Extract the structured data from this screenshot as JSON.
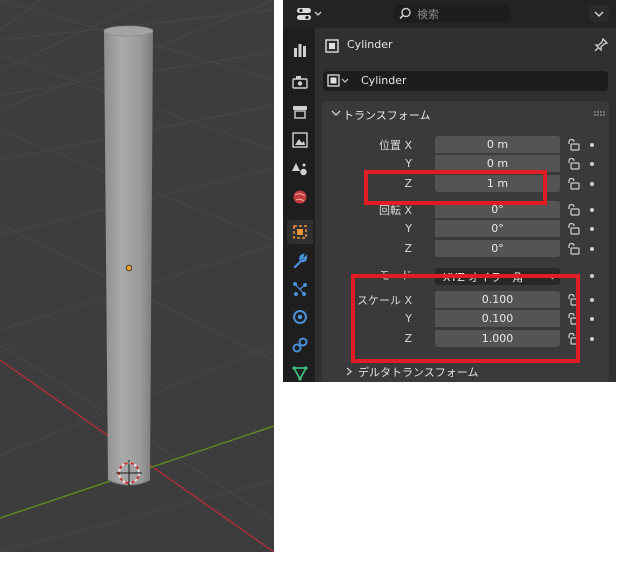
{
  "viewport": {
    "background": "#3d3d3d",
    "object": "cylinder",
    "x_axis_color": "#a8303a",
    "y_axis_color": "#5b8a1f"
  },
  "properties": {
    "search_placeholder": "検索",
    "object_name": "Cylinder",
    "datablock_name": "Cylinder",
    "panel_title": "トランスフォーム",
    "location": {
      "label_x": "位置 X",
      "label_y": "Y",
      "label_z": "Z",
      "x": "0 m",
      "y": "0 m",
      "z": "1 m"
    },
    "rotation": {
      "label_x": "回転 X",
      "label_y": "Y",
      "label_z": "Z",
      "x": "0°",
      "y": "0°",
      "z": "0°"
    },
    "mode": {
      "label": "モード",
      "value": "XYZ オイラー角"
    },
    "scale": {
      "label_x": "スケール X",
      "label_y": "Y",
      "label_z": "Z",
      "x": "0.100",
      "y": "0.100",
      "z": "1.000"
    },
    "delta_transform_title": "デルタトランスフォーム",
    "accent_color": "#e01c24",
    "active_tab": "object-properties"
  }
}
